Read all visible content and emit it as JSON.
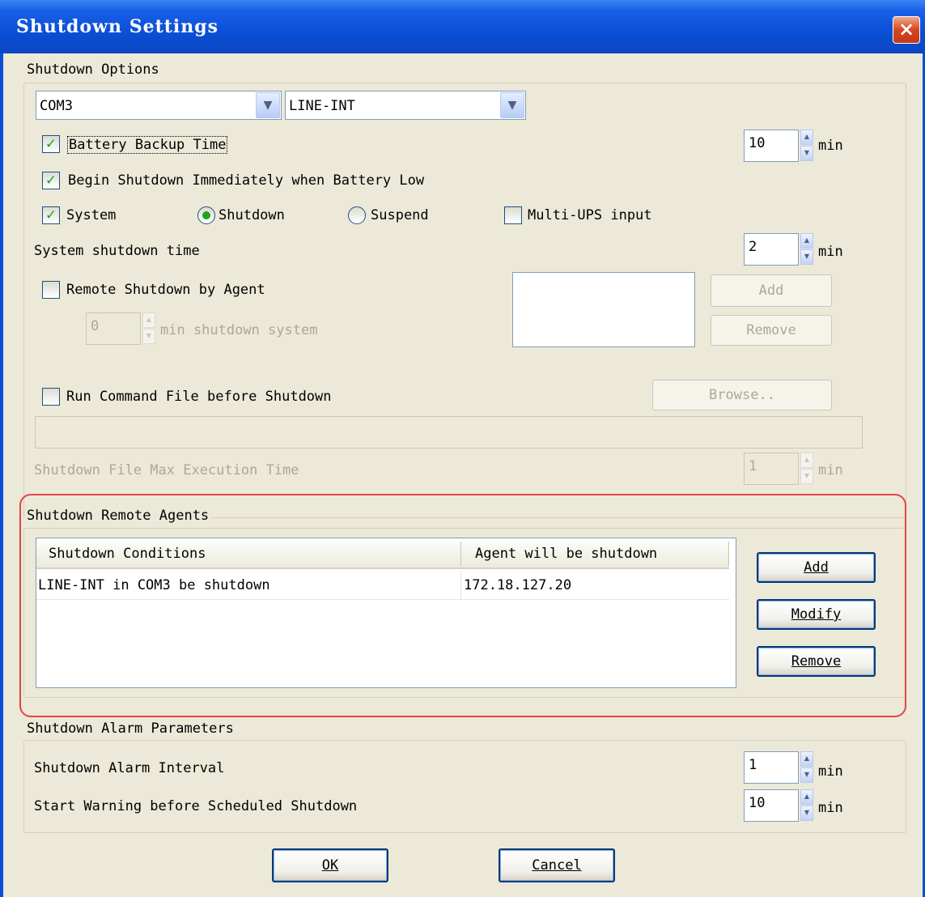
{
  "window": {
    "title": "Shutdown Settings",
    "close_glyph": "×"
  },
  "options": {
    "group_title": "Shutdown Options",
    "port": "COM3",
    "ups_type": "LINE-INT",
    "battery_backup": {
      "label": "Battery Backup Time",
      "checked": true,
      "value": "10",
      "unit": "min"
    },
    "battery_low": {
      "label": "Begin Shutdown Immediately when Battery Low",
      "checked": true
    },
    "system": {
      "label": "System",
      "checked": true
    },
    "mode_shutdown": {
      "label": "Shutdown",
      "selected": true
    },
    "mode_suspend": {
      "label": "Suspend",
      "selected": false
    },
    "multi_ups": {
      "label": "Multi-UPS input",
      "checked": false
    },
    "system_shutdown_time": {
      "label": "System shutdown time",
      "value": "2",
      "unit": "min"
    },
    "remote_agent": {
      "label": "Remote Shutdown by Agent",
      "checked": false,
      "value": "0",
      "unit": "min shutdown system",
      "add_label": "Add",
      "remove_label": "Remove"
    },
    "run_command": {
      "label": "Run Command File before Shutdown",
      "checked": false,
      "browse_label": "Browse..",
      "path": ""
    },
    "file_max_exec": {
      "label": "Shutdown File Max Execution Time",
      "value": "1",
      "unit": "min"
    }
  },
  "remote_agents": {
    "group_title": "Shutdown Remote Agents",
    "columns": [
      "Shutdown Conditions",
      "Agent will be shutdown"
    ],
    "rows": [
      {
        "condition": "LINE-INT in COM3 be shutdown",
        "agent": "172.18.127.20"
      }
    ],
    "add_label": "Add",
    "modify_label": "Modify",
    "remove_label": "Remove"
  },
  "alarm": {
    "group_title": "Shutdown Alarm Parameters",
    "interval": {
      "label": "Shutdown Alarm Interval",
      "value": "1",
      "unit": "min"
    },
    "warning": {
      "label": "Start Warning before Scheduled Shutdown",
      "value": "10",
      "unit": "min"
    }
  },
  "footer": {
    "ok_label": "OK",
    "cancel_label": "Cancel"
  },
  "colors": {
    "titlebar": "#0a4fd6",
    "dialog_bg": "#ece9d8",
    "check": "#21a121",
    "highlight": "#e0454b"
  }
}
